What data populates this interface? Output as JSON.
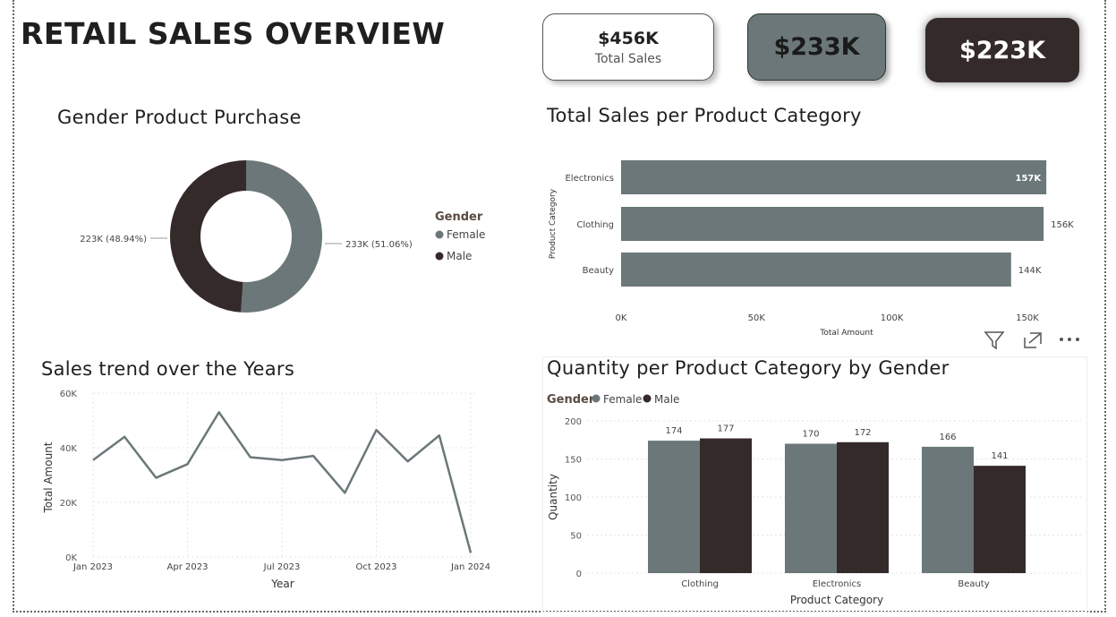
{
  "title": "RETAIL SALES OVERVIEW",
  "cards": [
    {
      "value": "$456K",
      "label": "Total Sales"
    },
    {
      "value": "$233K"
    },
    {
      "value": "$223K"
    }
  ],
  "colors": {
    "female": "#6b7779",
    "male": "#352a2a"
  },
  "visual_icons": [
    "filter-icon",
    "focus-mode-icon",
    "more-options-icon"
  ],
  "chart_data": [
    {
      "type": "pie",
      "title": "Gender Product Purchase",
      "legend_title": "Gender",
      "legend_position": "right",
      "slices": [
        {
          "name": "Female",
          "value": 233,
          "label": "233K (51.06%)"
        },
        {
          "name": "Male",
          "value": 223,
          "label": "223K (48.94%)"
        }
      ]
    },
    {
      "type": "bar",
      "orientation": "horizontal",
      "title": "Total Sales per Product Category",
      "categories": [
        "Electronics",
        "Clothing",
        "Beauty"
      ],
      "values": [
        157,
        156,
        144
      ],
      "value_labels": [
        "157K",
        "156K",
        "144K"
      ],
      "xlabel": "Total Amount",
      "ylabel": "Product Category",
      "xlim": [
        0,
        160
      ],
      "xticks": [
        0,
        50,
        100,
        150
      ],
      "xtick_labels": [
        "0K",
        "50K",
        "100K",
        "150K"
      ]
    },
    {
      "type": "line",
      "title": "Sales trend over the Years",
      "x": [
        "Jan 2023",
        "Feb 2023",
        "Mar 2023",
        "Apr 2023",
        "May 2023",
        "Jun 2023",
        "Jul 2023",
        "Aug 2023",
        "Sep 2023",
        "Oct 2023",
        "Nov 2023",
        "Dec 2023",
        "Jan 2024"
      ],
      "values": [
        35500,
        44000,
        29000,
        34000,
        53000,
        36500,
        35500,
        37000,
        23500,
        46500,
        35000,
        44500,
        1500
      ],
      "xtick_labels": [
        "Jan 2023",
        "Apr 2023",
        "Jul 2023",
        "Oct 2023",
        "Jan 2024"
      ],
      "xlabel": "Year",
      "ylabel": "Total Amount",
      "ylim": [
        0,
        60000
      ],
      "ytick_labels": [
        "0K",
        "20K",
        "40K",
        "60K"
      ],
      "grid": true
    },
    {
      "type": "bar",
      "title": "Quantity per Product Category by Gender",
      "legend_title": "Gender",
      "legend_position": "top-left",
      "categories": [
        "Clothing",
        "Electronics",
        "Beauty"
      ],
      "series": [
        {
          "name": "Female",
          "values": [
            174,
            170,
            166
          ]
        },
        {
          "name": "Male",
          "values": [
            177,
            172,
            141
          ]
        }
      ],
      "xlabel": "Product Category",
      "ylabel": "Quantity",
      "ylim": [
        0,
        200
      ],
      "yticks": [
        0,
        50,
        100,
        150,
        200
      ],
      "grid": true
    }
  ]
}
